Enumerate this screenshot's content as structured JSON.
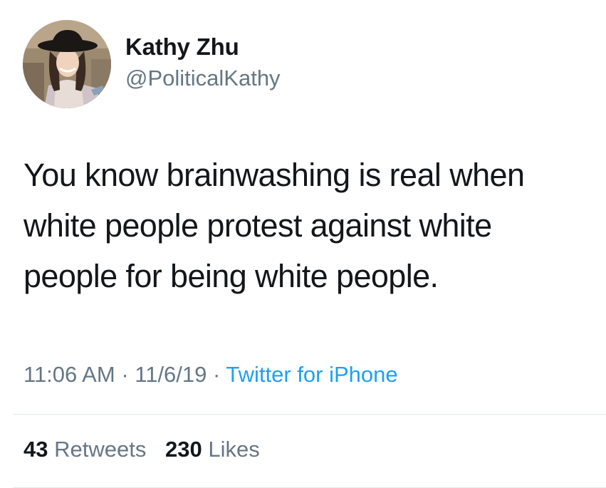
{
  "user": {
    "name": "Kathy Zhu",
    "handle": "@PoliticalKathy"
  },
  "tweet": {
    "lines": [
      "You know brainwashing is real when",
      "white people protest against white",
      "people for being white people."
    ],
    "time": "11:06 AM",
    "date": "11/6/19",
    "separator": "·",
    "source": "Twitter for iPhone"
  },
  "stats": {
    "retweets_count": "43",
    "retweets_label": "Retweets",
    "likes_count": "230",
    "likes_label": "Likes"
  },
  "colors": {
    "text": "#14171a",
    "secondary": "#657786",
    "link": "#1da1f2",
    "divider": "#e1e8ed"
  }
}
